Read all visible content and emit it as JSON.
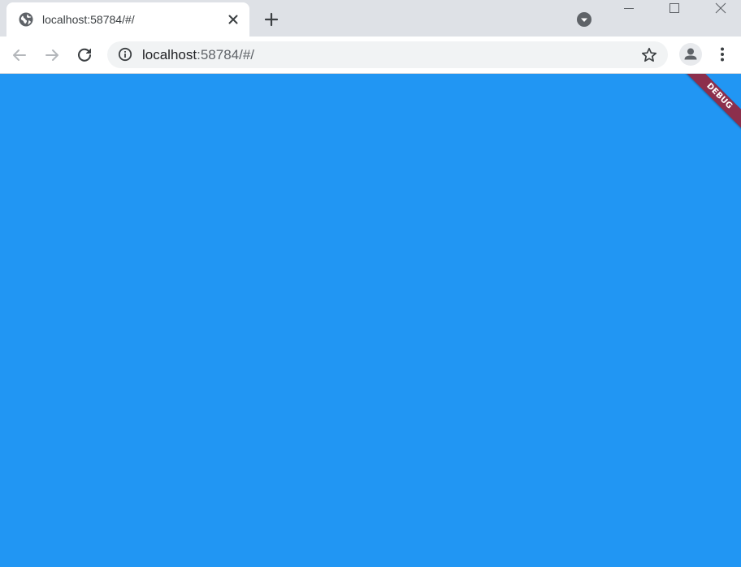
{
  "browser": {
    "tab": {
      "title": "localhost:58784/#/",
      "favicon": "globe-icon"
    },
    "omnibox": {
      "host": "localhost",
      "path": ":58784/#/"
    },
    "icons": {
      "new_tab": "plus-icon",
      "tab_search": "dropdown-circle-icon",
      "back": "arrow-left-icon",
      "forward": "arrow-right-icon",
      "reload": "reload-icon",
      "site_info": "info-icon",
      "bookmark": "star-icon",
      "profile": "person-icon",
      "menu": "kebab-menu-icon"
    }
  },
  "app": {
    "background_color": "#2196f3",
    "debug_banner": {
      "label": "DEBUG",
      "color": "#8c2f4c"
    }
  }
}
